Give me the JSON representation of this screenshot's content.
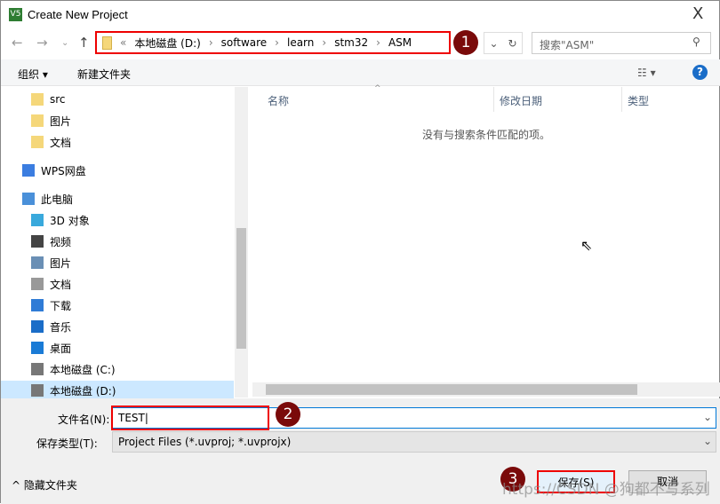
{
  "window": {
    "title": "Create New Project",
    "close": "X"
  },
  "address": {
    "prefix": "«",
    "segments": [
      "本地磁盘 (D:)",
      "software",
      "learn",
      "stm32",
      "ASM"
    ],
    "badge": "1"
  },
  "search": {
    "placeholder": "搜索\"ASM\""
  },
  "toolbar": {
    "organize": "组织 ▾",
    "new_folder": "新建文件夹",
    "view": "☷ ▾",
    "help": "?"
  },
  "tree": [
    {
      "label": "src",
      "icon": "folder-icon",
      "color": "#f5d77a"
    },
    {
      "label": "图片",
      "icon": "folder-icon",
      "color": "#f5d77a"
    },
    {
      "label": "文档",
      "icon": "folder-icon",
      "color": "#f5d77a"
    },
    {
      "label": "WPS网盘",
      "icon": "cloud-icon",
      "color": "#3b7de0"
    },
    {
      "label": "此电脑",
      "icon": "computer-icon",
      "color": "#4a90d9"
    },
    {
      "label": "3D 对象",
      "icon": "cube-icon",
      "color": "#39a9dc"
    },
    {
      "label": "视频",
      "icon": "video-icon",
      "color": "#444"
    },
    {
      "label": "图片",
      "icon": "picture-icon",
      "color": "#6a8fb5"
    },
    {
      "label": "文档",
      "icon": "document-icon",
      "color": "#999"
    },
    {
      "label": "下载",
      "icon": "download-icon",
      "color": "#2f7bd6"
    },
    {
      "label": "音乐",
      "icon": "music-icon",
      "color": "#1a6dc8"
    },
    {
      "label": "桌面",
      "icon": "desktop-icon",
      "color": "#1a7bd6"
    },
    {
      "label": "本地磁盘 (C:)",
      "icon": "drive-icon",
      "color": "#777"
    },
    {
      "label": "本地磁盘 (D:)",
      "icon": "drive-icon",
      "color": "#777",
      "selected": true
    }
  ],
  "columns": [
    "名称",
    "修改日期",
    "类型"
  ],
  "empty_message": "没有与搜索条件匹配的项。",
  "filename": {
    "label": "文件名(N):",
    "value": "TEST",
    "badge": "2"
  },
  "filetype": {
    "label": "保存类型(T):",
    "value": "Project Files (*.uvproj; *.uvprojx)"
  },
  "hide_folders": "隐藏文件夹",
  "buttons": {
    "save": "保存(S)",
    "cancel": "取消",
    "badge": "3"
  },
  "watermark": "https://CSDN @狗都不写系列",
  "colors": {
    "annotation_border": "#e00000",
    "badge": "#7a0a0a",
    "accent": "#0078d7"
  }
}
